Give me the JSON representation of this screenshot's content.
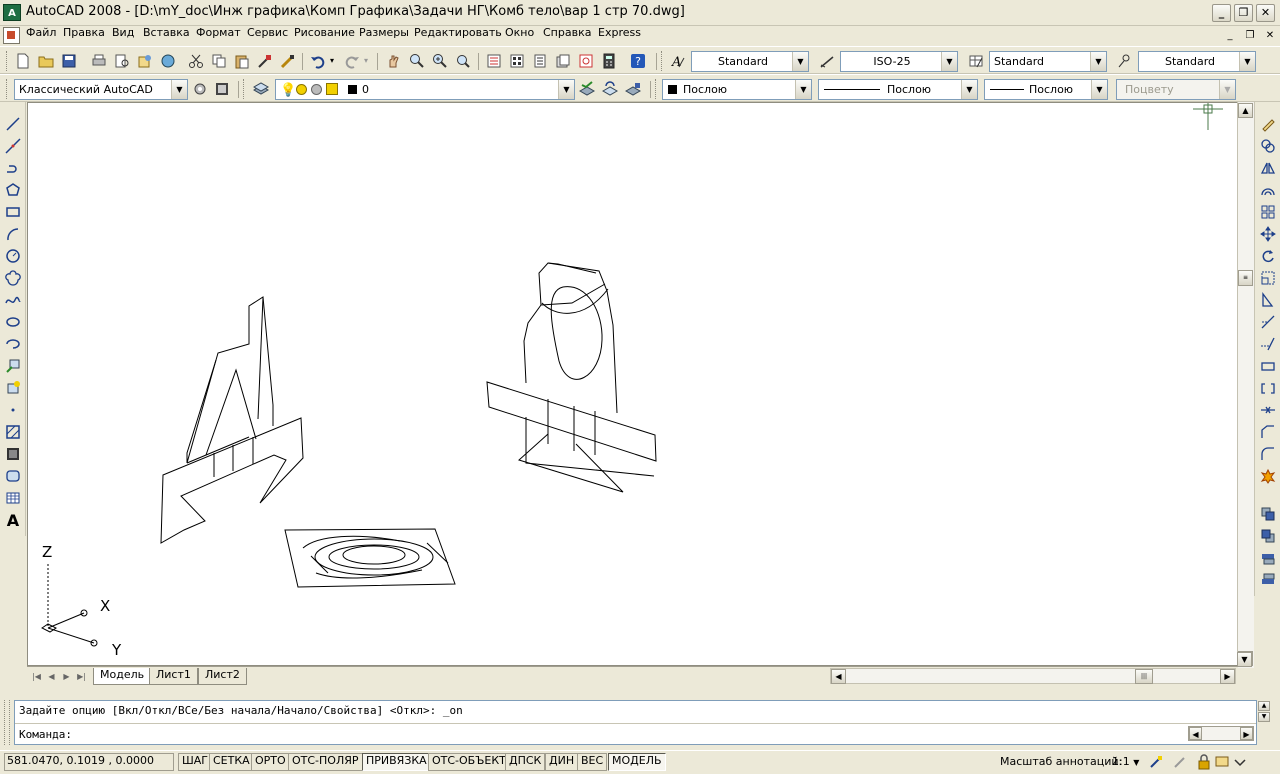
{
  "window": {
    "title": "AutoCAD 2008 - [D:\\mY_doc\\Инж графика\\Комп Графика\\Задачи НГ\\Комб тело\\вар 1 стр 70.dwg]",
    "app_icon_text": "A",
    "controls": {
      "minimize": "_",
      "maximize": "❐",
      "close": "✕"
    }
  },
  "menu": {
    "items": [
      "Файл",
      "Правка",
      "Вид",
      "Вставка",
      "Формат",
      "Сервис",
      "Рисование",
      "Размеры",
      "Редактировать",
      "Окно",
      "Справка",
      "Express"
    ],
    "doc_controls": {
      "minimize": "_",
      "restore": "❐",
      "close": "✕"
    }
  },
  "toolbar_styles": {
    "text_style": "Standard",
    "dim_style": "ISO-25",
    "table_style": "Standard",
    "multileader_style": "Standard"
  },
  "toolbar_layers": {
    "workspace": "Классический AutoCAD",
    "layer": "0",
    "color": "Послою",
    "linetype": "Послою",
    "lineweight": "Послою",
    "plotstyle": "Поцвету"
  },
  "layout_tabs": [
    "Модель",
    "Лист1",
    "Лист2"
  ],
  "active_tab": "Модель",
  "ucs": {
    "z": "Z",
    "x": "X",
    "y": "Y"
  },
  "command": {
    "history": "Задайте опцию [Вкл/Откл/ВСе/Без начала/Начало/Свойства] <Откл>: _on",
    "prompt": "Команда:"
  },
  "status": {
    "coords": "581.0470, 0.1019 , 0.0000",
    "toggles": [
      {
        "label": "ШАГ",
        "on": false
      },
      {
        "label": "СЕТКА",
        "on": false
      },
      {
        "label": "ОРТО",
        "on": false
      },
      {
        "label": "ОТС-ПОЛЯР",
        "on": false
      },
      {
        "label": "ПРИВЯЗКА",
        "on": true
      },
      {
        "label": "ОТС-ОБЪЕКТ",
        "on": false
      },
      {
        "label": "ДПСК",
        "on": false
      },
      {
        "label": "ДИН",
        "on": false
      },
      {
        "label": "ВЕС",
        "on": false
      },
      {
        "label": "МОДЕЛЬ",
        "on": true
      }
    ],
    "annotation_scale_label": "Масштаб аннотаций:",
    "annotation_scale": "1:1"
  },
  "colors": {
    "layer_color_swatch": "#000000",
    "app_icon": "#1f6e43"
  }
}
